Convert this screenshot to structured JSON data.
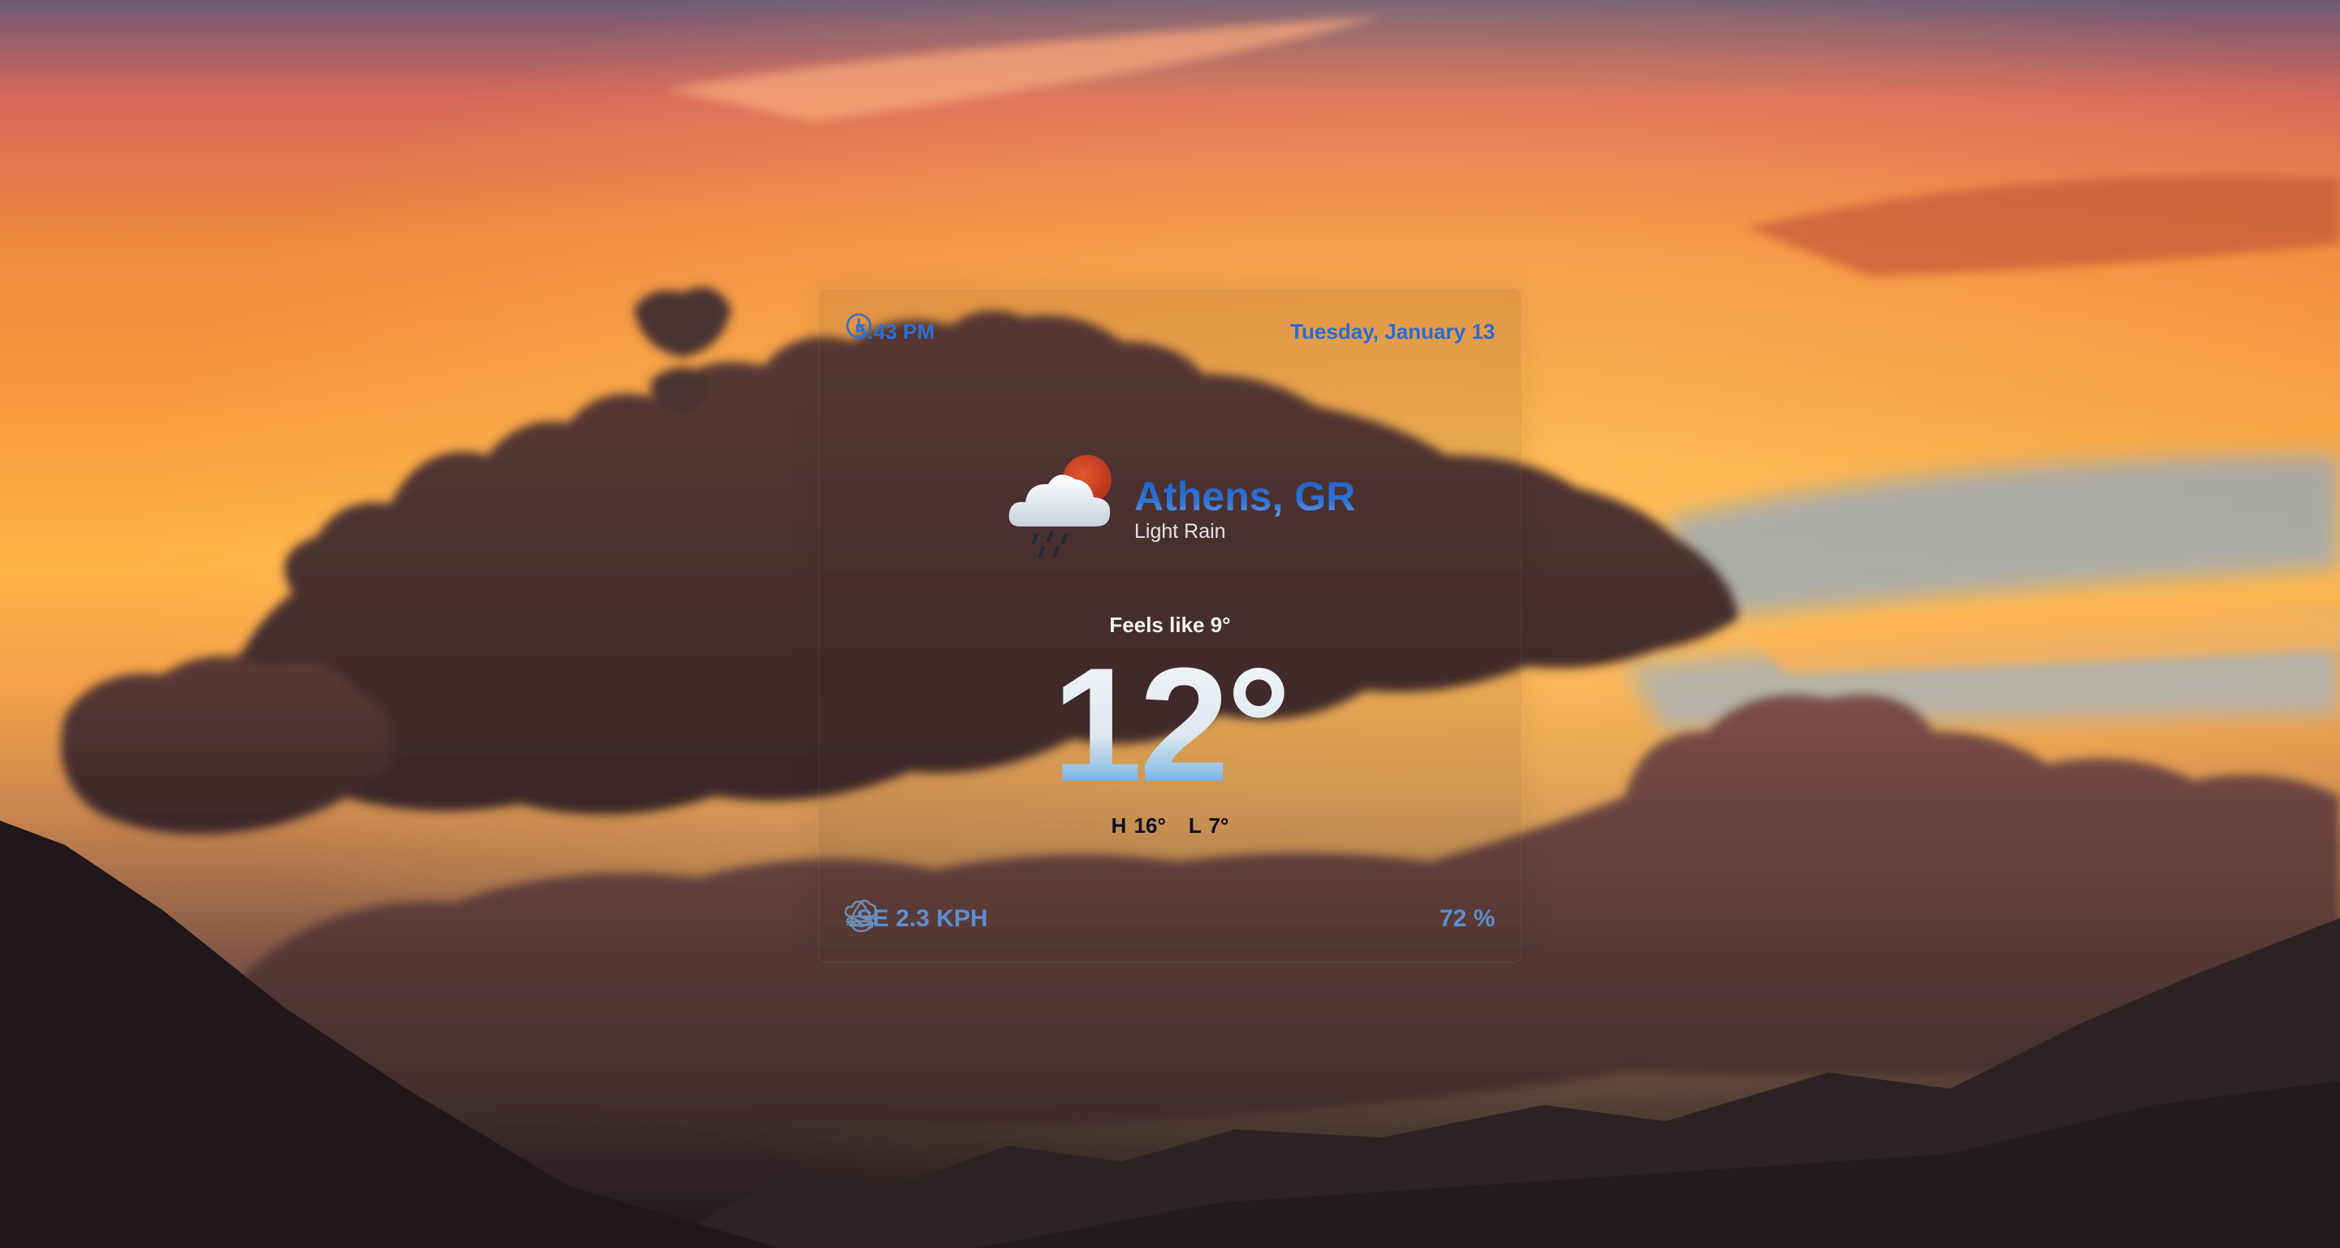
{
  "widget": {
    "time": "5:43 PM",
    "date": "Tuesday, January 13",
    "city": "Athens, GR",
    "condition": "Light Rain",
    "feels_like": "Feels like 9°",
    "temperature": "12°",
    "high": "H 16°",
    "low": "L 7°",
    "wind": "SE 2.3 KPH",
    "humidity": "72 %"
  },
  "icons": {
    "clock": "clock-icon",
    "weather": "cloud-rain-sun-icon",
    "wind": "wind-cloud-icon",
    "humidity": "humidity-drop-icon"
  },
  "colors": {
    "accent": "#2f6fd0",
    "stat_text": "#5b8fcf",
    "sky_top": "#6d5a77",
    "sky_orange": "#f08a3c",
    "sky_bottom": "#1e1618"
  }
}
